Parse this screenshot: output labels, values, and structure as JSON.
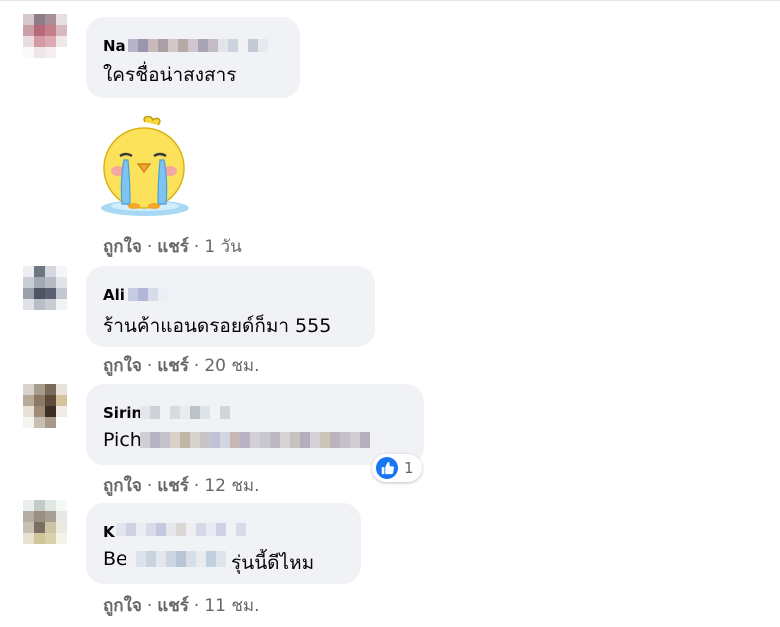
{
  "comments": [
    {
      "author": "Na",
      "text": "ใครชื่อน่าสงสาร",
      "actions": {
        "like": "ถูกใจ",
        "reply": "แชร์",
        "time": "1 วัน"
      },
      "sticker": "crying-chick-sticker"
    },
    {
      "author": "Ali",
      "text": "ร้านค้าแอนดรอยด์ก็มา 555",
      "actions": {
        "like": "ถูกใจ",
        "reply": "แชร์",
        "time": "20 ชม."
      }
    },
    {
      "author": "Sirin",
      "text": "Pich",
      "actions": {
        "like": "ถูกใจ",
        "reply": "แชร์",
        "time": "12 ชม."
      },
      "reaction": {
        "icon": "like-icon",
        "count": "1"
      }
    },
    {
      "author": "K",
      "text_prefix": "Be",
      "text": "รุ่นนี้ดีไหม",
      "actions": {
        "like": "ถูกใจ",
        "reply": "แชร์",
        "time": "11 ชม."
      }
    }
  ],
  "separator": "·",
  "colors": {
    "bubble": "#f0f2f5",
    "secondary_text": "#65676b",
    "like_blue": "#1877f2"
  }
}
